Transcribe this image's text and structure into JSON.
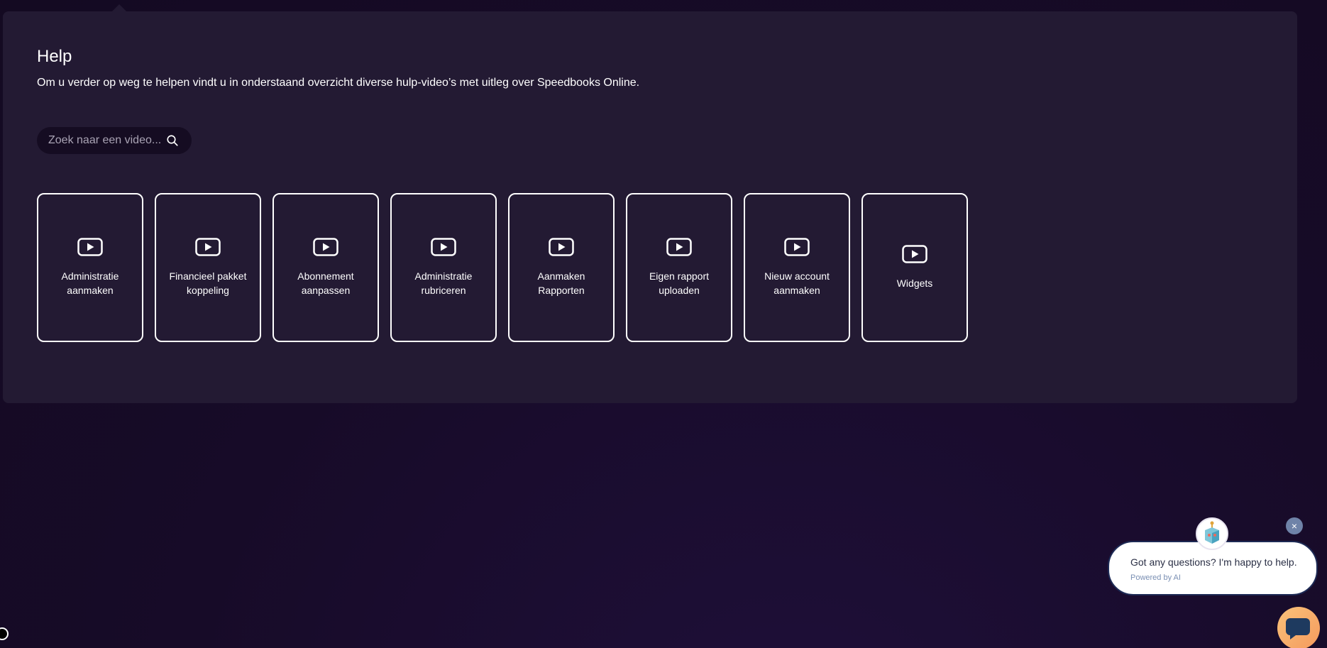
{
  "help": {
    "title": "Help",
    "subtitle": "Om u verder op weg te helpen vindt u in onderstaand overzicht diverse hulp-video’s met uitleg over Speedbooks Online."
  },
  "search": {
    "placeholder": "Zoek naar een video...",
    "value": "",
    "icon": "search-icon"
  },
  "videos": [
    {
      "label": "Administratie aanmaken",
      "icon": "play-icon"
    },
    {
      "label": "Financieel pakket koppeling",
      "icon": "play-icon"
    },
    {
      "label": "Abonnement aanpassen",
      "icon": "play-icon"
    },
    {
      "label": "Administratie rubriceren",
      "icon": "play-icon"
    },
    {
      "label": "Aanmaken Rapporten",
      "icon": "play-icon"
    },
    {
      "label": "Eigen rapport uploaden",
      "icon": "play-icon"
    },
    {
      "label": "Nieuw account aanmaken",
      "icon": "play-icon"
    },
    {
      "label": "Widgets",
      "icon": "play-icon"
    }
  ],
  "chat": {
    "message": "Got any questions? I'm happy to help.",
    "powered_by": "Powered by AI",
    "close_label": "×",
    "avatar_icon": "robot-icon",
    "launcher_icon": "chat-icon"
  },
  "colors": {
    "background": "#170b28",
    "panel": "#231a33",
    "text": "#ffffff",
    "launcher": "#f59a5d",
    "close": "#6f83a8"
  }
}
